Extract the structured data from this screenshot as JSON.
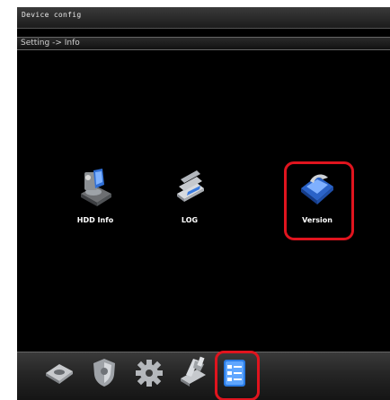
{
  "window": {
    "title": "Device config"
  },
  "breadcrumb": {
    "path": "Setting -> Info"
  },
  "info_items": [
    {
      "label": "HDD Info",
      "icon": "hard-disk-icon"
    },
    {
      "label": "LOG",
      "icon": "log-pages-icon"
    },
    {
      "label": "Version",
      "icon": "version-book-icon",
      "selected": true
    }
  ],
  "dock": [
    {
      "icon": "disc-icon"
    },
    {
      "icon": "shield-icon"
    },
    {
      "icon": "gear-icon"
    },
    {
      "icon": "tools-icon"
    },
    {
      "icon": "info-checklist-icon",
      "selected": true
    }
  ],
  "colors": {
    "selection": "#e0141e",
    "background": "#000000",
    "label": "#ffffff"
  }
}
